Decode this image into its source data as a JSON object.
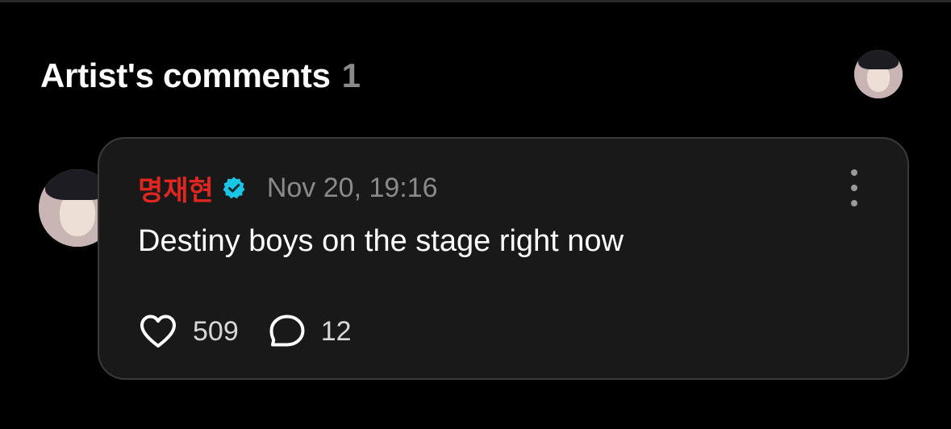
{
  "header": {
    "title": "Artist's comments",
    "count": "1"
  },
  "current_user": {
    "avatar_icon": "user-avatar"
  },
  "comment": {
    "author": "명재현",
    "verified_icon": "verified-badge-icon",
    "timestamp": "Nov 20, 19:16",
    "text": "Destiny boys on the stage right now",
    "likes": "509",
    "replies": "12",
    "more_icon": "more-vertical-icon"
  },
  "colors": {
    "background": "#000000",
    "card": "#191919",
    "card_border": "#3a3a3a",
    "author_name": "#e0261f",
    "verified_badge": "#19c6e6",
    "muted_text": "#8a8a8a"
  }
}
